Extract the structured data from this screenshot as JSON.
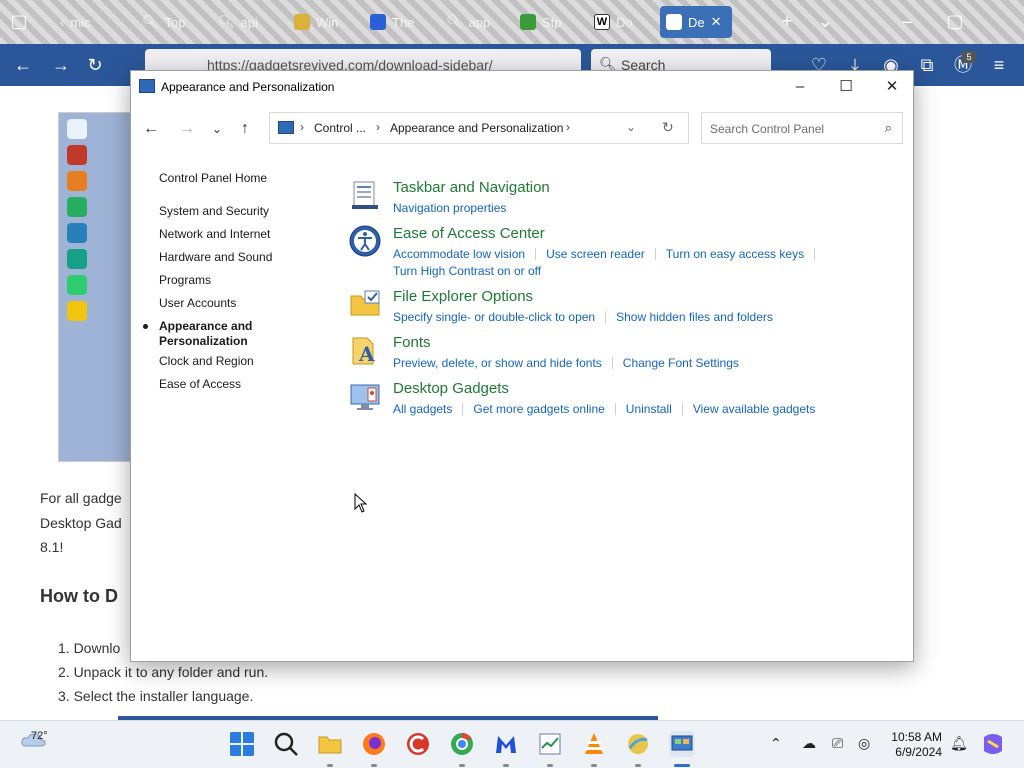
{
  "browser": {
    "tabs": [
      {
        "label": "mic"
      },
      {
        "label": "Top"
      },
      {
        "label": "api"
      },
      {
        "label": "Win"
      },
      {
        "label": "The"
      },
      {
        "label": "app"
      },
      {
        "label": "Stp"
      },
      {
        "label": "Do"
      }
    ],
    "active_tab": {
      "label": "De"
    },
    "url": "https://gadgetsrevived.com/download-sidebar/",
    "search_placeholder": "Search",
    "extension_badge": "5"
  },
  "webpage": {
    "para_lines": [
      "For all gadge",
      "Desktop Gad",
      "8.1!"
    ],
    "heading": "How to D",
    "steps": [
      "1. Downlo",
      "2. Unpack it to any folder and run.",
      "3. Select the installer language."
    ]
  },
  "window": {
    "title": "Appearance and Personalization",
    "address": {
      "crumb1": "Control ...",
      "crumb2": "Appearance and Personalization"
    },
    "search_placeholder": "Search Control Panel",
    "left_nav": {
      "home": "Control Panel Home",
      "items": [
        "System and Security",
        "Network and Internet",
        "Hardware and Sound",
        "Programs",
        "User Accounts"
      ],
      "current_line1": "Appearance and",
      "current_line2": "Personalization",
      "after": [
        "Clock and Region",
        "Ease of Access"
      ]
    },
    "categories": {
      "taskbar": {
        "title": "Taskbar and Navigation",
        "links": [
          "Navigation properties"
        ]
      },
      "ease": {
        "title": "Ease of Access Center",
        "links": [
          "Accommodate low vision",
          "Use screen reader",
          "Turn on easy access keys",
          "Turn High Contrast on or off"
        ]
      },
      "explorer": {
        "title": "File Explorer Options",
        "links": [
          "Specify single- or double-click to open",
          "Show hidden files and folders"
        ]
      },
      "fonts": {
        "title": "Fonts",
        "links": [
          "Preview, delete, or show and hide fonts",
          "Change Font Settings"
        ]
      },
      "gadgets": {
        "title": "Desktop Gadgets",
        "links": [
          "All gadgets",
          "Get more gadgets online",
          "Uninstall",
          "View available gadgets"
        ]
      }
    }
  },
  "taskbar": {
    "temperature": "72°",
    "time": "10:58 AM",
    "date": "6/9/2024"
  },
  "colors": {
    "category_title": "#1e7b34",
    "link": "#1565c0",
    "browser_bar": "#2b579a"
  }
}
